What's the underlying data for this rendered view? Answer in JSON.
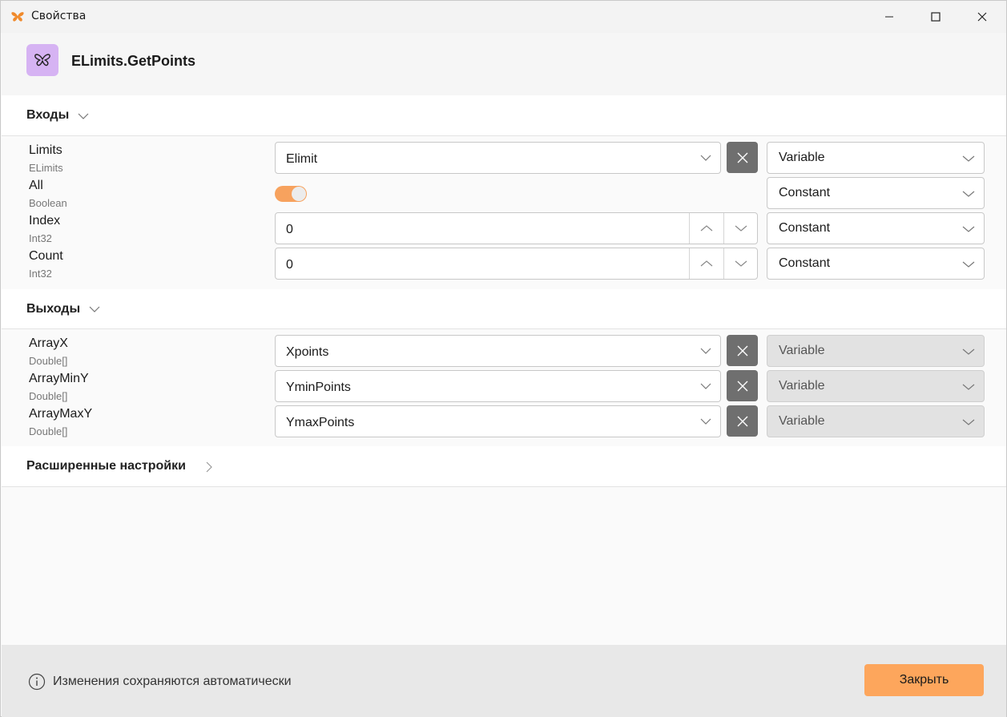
{
  "window": {
    "title": "Свойства",
    "accent": "#fda65c"
  },
  "header": {
    "title": "ELimits.GetPoints",
    "icon": "butterfly-icon"
  },
  "inputs": {
    "title": "Входы",
    "rows": [
      {
        "name": "Limits",
        "type": "ELimits",
        "value": "Elimit",
        "mode": "Variable"
      },
      {
        "name": "All",
        "type": "Boolean",
        "value": "",
        "mode": "Constant"
      },
      {
        "name": "Index",
        "type": "Int32",
        "value": "0",
        "mode": "Constant"
      },
      {
        "name": "Count",
        "type": "Int32",
        "value": "0",
        "mode": "Constant"
      }
    ]
  },
  "outputs": {
    "title": "Выходы",
    "rows": [
      {
        "name": "ArrayX",
        "type": "Double[]",
        "value": "Xpoints",
        "mode": "Variable"
      },
      {
        "name": "ArrayMinY",
        "type": "Double[]",
        "value": "YminPoints",
        "mode": "Variable"
      },
      {
        "name": "ArrayMaxY",
        "type": "Double[]",
        "value": "YmaxPoints",
        "mode": "Variable"
      }
    ]
  },
  "advanced": {
    "title": "Расширенные настройки"
  },
  "footer": {
    "info": "Изменения сохраняются автоматически",
    "close_label": "Закрыть"
  }
}
